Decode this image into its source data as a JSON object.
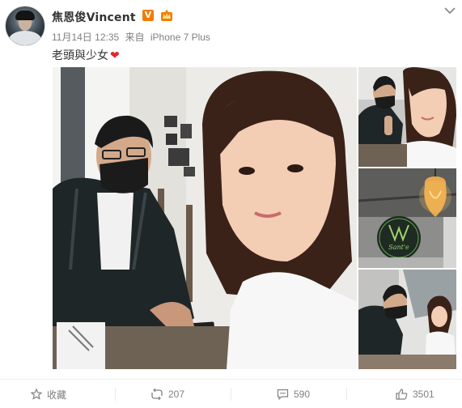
{
  "post": {
    "username": "焦恩俊Vincent",
    "verified_badge": "V",
    "date": "11月14日 12:35",
    "source_prefix": "来自",
    "source": "iPhone 7 Plus",
    "text": "老頭與少女",
    "heart": "❤"
  },
  "media": {
    "main_photo": "selfie-man-in-mask-and-girl",
    "thumbs": [
      "selfie-winking-girl",
      "lamp-and-cafe-sign",
      "selfie-in-cafe"
    ],
    "sign_text": "Sant'e"
  },
  "actions": {
    "favorite_label": "收藏",
    "repost_count": "207",
    "comment_count": "590",
    "like_count": "3501"
  },
  "icons": {
    "favorite": "star-icon",
    "repost": "repost-icon",
    "comment": "comment-icon",
    "like": "thumbs-up-icon",
    "menu": "chevron-down-icon"
  },
  "colors": {
    "text": "#333333",
    "muted": "#808080",
    "verified": "#f57b00",
    "heart": "#e0282e"
  }
}
